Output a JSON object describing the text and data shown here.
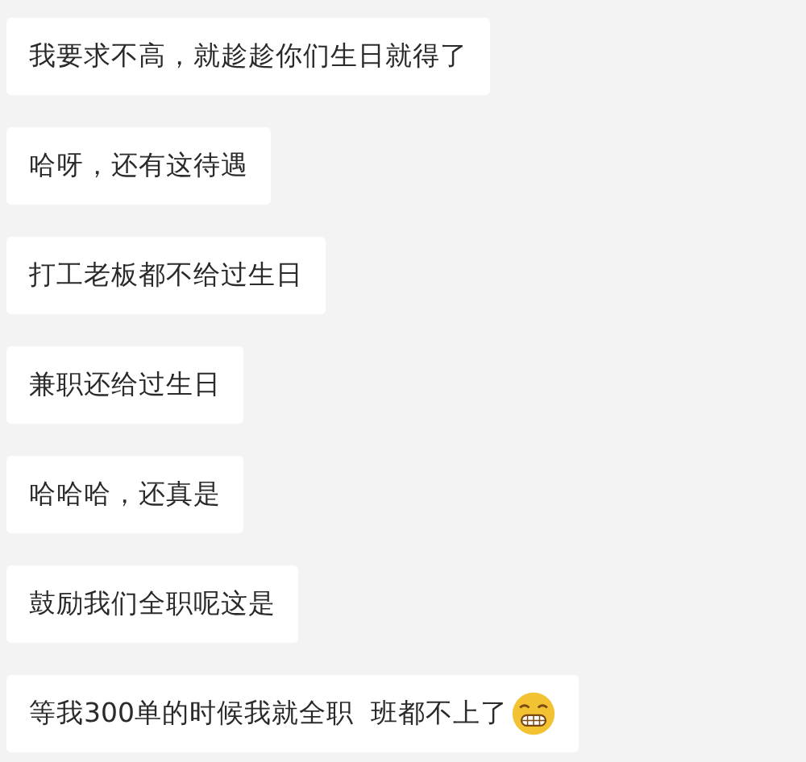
{
  "messages": [
    {
      "kind": "plain",
      "text": "我要求不高，就趁趁你们生日就得了"
    },
    {
      "kind": "plain",
      "text": "哈呀，还有这待遇"
    },
    {
      "kind": "plain",
      "text": "打工老板都不给过生日"
    },
    {
      "kind": "plain",
      "text": "兼职还给过生日"
    },
    {
      "kind": "plain",
      "text": "哈哈哈，还真是"
    },
    {
      "kind": "plain",
      "text": "鼓励我们全职呢这是"
    },
    {
      "kind": "with_emoji",
      "text": "等我300单的时候我就全职  班都不上了"
    }
  ]
}
